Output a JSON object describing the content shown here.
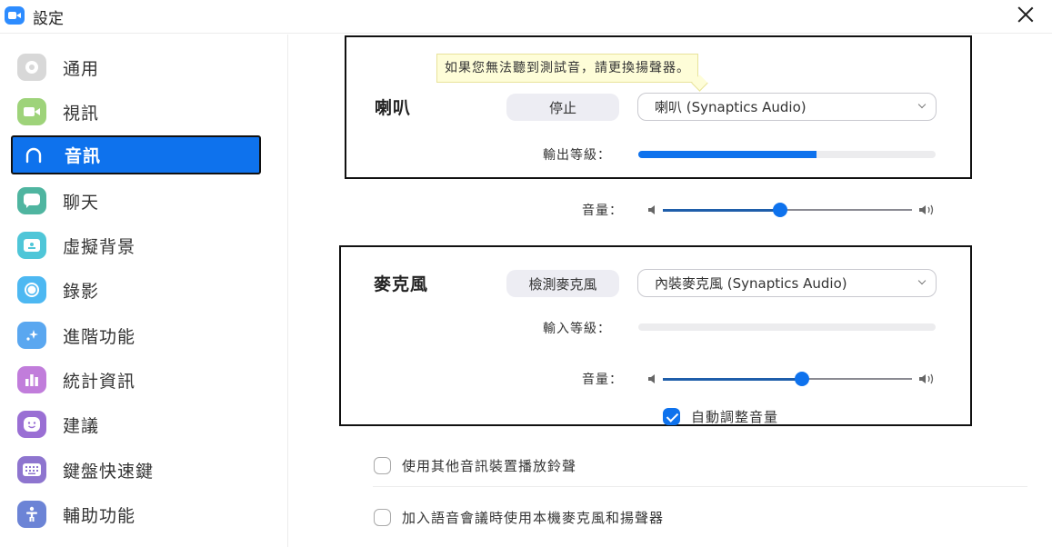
{
  "window": {
    "title": "設定",
    "close_label": "×"
  },
  "sidebar": {
    "items": [
      {
        "label": "通用",
        "icon": "gear-icon",
        "color": "#d8d8d8",
        "active": false
      },
      {
        "label": "視訊",
        "icon": "video-camera-icon",
        "color": "#9ed37a",
        "active": false
      },
      {
        "label": "音訊",
        "icon": "headphones-icon",
        "color": "#0e72ed",
        "active": true
      },
      {
        "label": "聊天",
        "icon": "chat-bubble-icon",
        "color": "#4fb5a0",
        "active": false
      },
      {
        "label": "虛擬背景",
        "icon": "virtual-background-icon",
        "color": "#4fc6d8",
        "active": false
      },
      {
        "label": "錄影",
        "icon": "record-icon",
        "color": "#4db8f2",
        "active": false
      },
      {
        "label": "進階功能",
        "icon": "sparkle-icon",
        "color": "#5aa7f0",
        "active": false
      },
      {
        "label": "統計資訊",
        "icon": "bar-chart-icon",
        "color": "#c17ddb",
        "active": false
      },
      {
        "label": "建議",
        "icon": "smiley-icon",
        "color": "#9a6fd4",
        "active": false
      },
      {
        "label": "鍵盤快速鍵",
        "icon": "keyboard-icon",
        "color": "#8e75cf",
        "active": false
      },
      {
        "label": "輔助功能",
        "icon": "accessibility-icon",
        "color": "#6c84d6",
        "active": false
      }
    ]
  },
  "speaker": {
    "title": "喇叭",
    "tooltip": "如果您無法聽到測試音，請更換揚聲器。",
    "test_button": "停止",
    "device": "喇叭 (Synaptics Audio)",
    "output_level_label": "輸出等級：",
    "output_level": 0.6,
    "volume_label": "音量：",
    "volume": 0.47
  },
  "microphone": {
    "title": "麥克風",
    "test_button": "檢測麥克風",
    "device": "內裝麥克風 (Synaptics Audio)",
    "input_level_label": "輸入等級：",
    "input_level": 0.0,
    "volume_label": "音量：",
    "volume": 0.56,
    "auto_adjust_label": "自動調整音量",
    "auto_adjust": true
  },
  "options": [
    {
      "label": "使用其他音訊裝置播放鈴聲",
      "checked": false
    },
    {
      "label": "加入語音會議時使用本機麥克風和揚聲器",
      "checked": false
    }
  ],
  "colors": {
    "accent": "#0e72ed",
    "tooltip_bg": "#fefdd8"
  }
}
